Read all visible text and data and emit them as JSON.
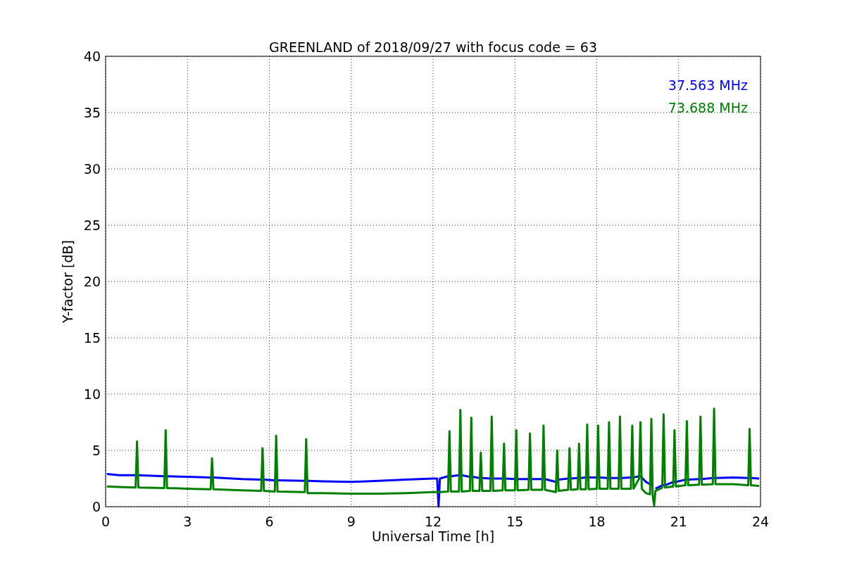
{
  "chart_data": {
    "type": "line",
    "grid": true,
    "title": "GREENLAND of 2018/09/27 with focus code = 63",
    "xlabel": "Universal Time [h]",
    "ylabel": "Y-factor [dB]",
    "xlim": [
      0,
      24
    ],
    "ylim": [
      0,
      40
    ],
    "xticks": [
      0,
      3,
      6,
      9,
      12,
      15,
      18,
      21,
      24
    ],
    "yticks": [
      0,
      5,
      10,
      15,
      20,
      25,
      30,
      35,
      40
    ],
    "x": [
      0.05,
      0.5,
      1.1,
      1.15,
      1.2,
      2.15,
      2.2,
      2.25,
      3,
      3.85,
      3.9,
      3.95,
      5,
      5.7,
      5.75,
      5.8,
      6.2,
      6.25,
      6.3,
      7.3,
      7.35,
      7.4,
      8,
      9,
      10,
      11,
      12,
      12.15,
      12.2,
      12.25,
      12.55,
      12.6,
      12.65,
      12.95,
      13,
      13.05,
      13.35,
      13.4,
      13.45,
      13.7,
      13.75,
      13.8,
      14.1,
      14.15,
      14.2,
      14.55,
      14.6,
      14.65,
      15,
      15.05,
      15.1,
      15.5,
      15.55,
      15.6,
      16,
      16.05,
      16.1,
      16.5,
      16.55,
      16.6,
      16.95,
      17,
      17.05,
      17.3,
      17.35,
      17.4,
      17.6,
      17.65,
      17.7,
      18,
      18.05,
      18.1,
      18.4,
      18.45,
      18.5,
      18.8,
      18.85,
      18.9,
      19.25,
      19.3,
      19.35,
      19.55,
      19.6,
      19.65,
      19.8,
      19.95,
      20,
      20.05,
      20.1,
      20.15,
      20.4,
      20.45,
      20.5,
      20.8,
      20.85,
      20.9,
      21.25,
      21.3,
      21.35,
      21.75,
      21.8,
      21.85,
      22.25,
      22.3,
      22.35,
      23,
      23.55,
      23.6,
      23.65,
      23.95
    ],
    "series": [
      {
        "name": "37.563 MHz",
        "color": "#0000ff",
        "values": [
          2.9,
          2.8,
          2.8,
          2.8,
          2.8,
          2.7,
          2.7,
          2.7,
          2.65,
          2.6,
          2.6,
          2.6,
          2.45,
          2.4,
          2.4,
          2.4,
          2.35,
          2.35,
          2.35,
          2.3,
          2.3,
          2.3,
          2.25,
          2.2,
          2.3,
          2.4,
          2.5,
          2.5,
          0,
          2.5,
          2.7,
          2.7,
          2.7,
          2.8,
          2.8,
          2.8,
          2.65,
          2.65,
          2.65,
          2.55,
          2.55,
          2.55,
          2.5,
          2.5,
          2.5,
          2.5,
          2.5,
          2.5,
          2.45,
          2.45,
          2.45,
          2.45,
          2.45,
          2.45,
          2.45,
          2.45,
          2.45,
          2.2,
          2.2,
          2.4,
          2.5,
          2.5,
          2.5,
          2.55,
          2.55,
          2.55,
          2.6,
          2.6,
          2.6,
          2.6,
          2.6,
          2.6,
          2.55,
          2.55,
          2.55,
          2.55,
          2.55,
          2.55,
          2.6,
          2.6,
          2.6,
          2.7,
          2.7,
          2.6,
          2.2,
          2.0,
          2.0,
          1.8,
          null,
          1.6,
          1.9,
          1.9,
          1.9,
          2.2,
          2.2,
          2.2,
          2.4,
          2.4,
          2.4,
          2.45,
          2.45,
          2.45,
          2.55,
          2.55,
          2.55,
          2.6,
          2.55,
          2.55,
          2.55,
          2.5
        ]
      },
      {
        "name": "73.688 MHz",
        "color": "#008000",
        "values": [
          1.8,
          1.75,
          1.7,
          5.8,
          1.7,
          1.65,
          6.8,
          1.65,
          1.6,
          1.55,
          4.3,
          1.55,
          1.45,
          1.4,
          5.2,
          1.4,
          1.35,
          6.3,
          1.35,
          1.3,
          6.0,
          1.2,
          1.2,
          1.15,
          1.15,
          1.2,
          1.3,
          1.3,
          1.3,
          1.3,
          1.35,
          6.7,
          1.35,
          1.35,
          8.6,
          1.35,
          1.4,
          7.9,
          1.4,
          1.4,
          4.8,
          1.4,
          1.4,
          8.0,
          1.4,
          1.45,
          5.6,
          1.45,
          1.45,
          6.8,
          1.45,
          1.5,
          6.5,
          1.5,
          1.5,
          7.2,
          1.5,
          1.3,
          5.0,
          1.4,
          1.5,
          5.2,
          1.5,
          1.55,
          5.6,
          1.55,
          1.55,
          7.3,
          1.55,
          1.6,
          7.2,
          1.6,
          1.6,
          7.5,
          1.6,
          1.6,
          8.0,
          1.6,
          1.6,
          7.2,
          1.6,
          2.5,
          7.5,
          1.6,
          1.2,
          1.1,
          7.8,
          1.0,
          0.1,
          1.4,
          1.7,
          8.2,
          1.7,
          1.8,
          6.8,
          1.8,
          1.9,
          7.6,
          1.9,
          1.95,
          8.0,
          1.95,
          2.0,
          8.7,
          2.0,
          2.0,
          1.9,
          6.9,
          1.9,
          1.85
        ]
      }
    ]
  }
}
